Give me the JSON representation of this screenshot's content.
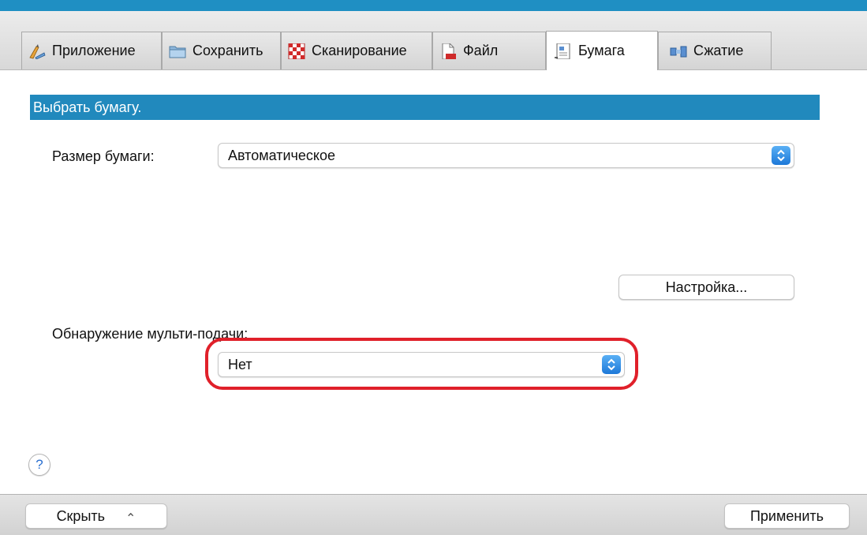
{
  "tabs": [
    {
      "label": "Приложение",
      "icon": "pencil-ruler-icon"
    },
    {
      "label": "Сохранить",
      "icon": "folder-icon"
    },
    {
      "label": "Сканирование",
      "icon": "checkerboard-icon"
    },
    {
      "label": "Файл",
      "icon": "file-icon"
    },
    {
      "label": "Бумага",
      "icon": "paper-icon",
      "active": true
    },
    {
      "label": "Сжатие",
      "icon": "compression-icon"
    }
  ],
  "section": {
    "title": "Выбрать бумагу."
  },
  "paper_size": {
    "label": "Размер бумаги:",
    "value": "Автоматическое"
  },
  "settings_button": {
    "label": "Настройка..."
  },
  "multifeed": {
    "label": "Обнаружение мульти-подачи:",
    "value": "Нет"
  },
  "help": {
    "symbol": "?"
  },
  "footer": {
    "hide_label": "Скрыть",
    "hide_chevron": "⌃",
    "apply_label": "Применить"
  },
  "colors": {
    "accent": "#2189bd",
    "highlight": "#e0202a",
    "stepper": "#1d78d8"
  }
}
